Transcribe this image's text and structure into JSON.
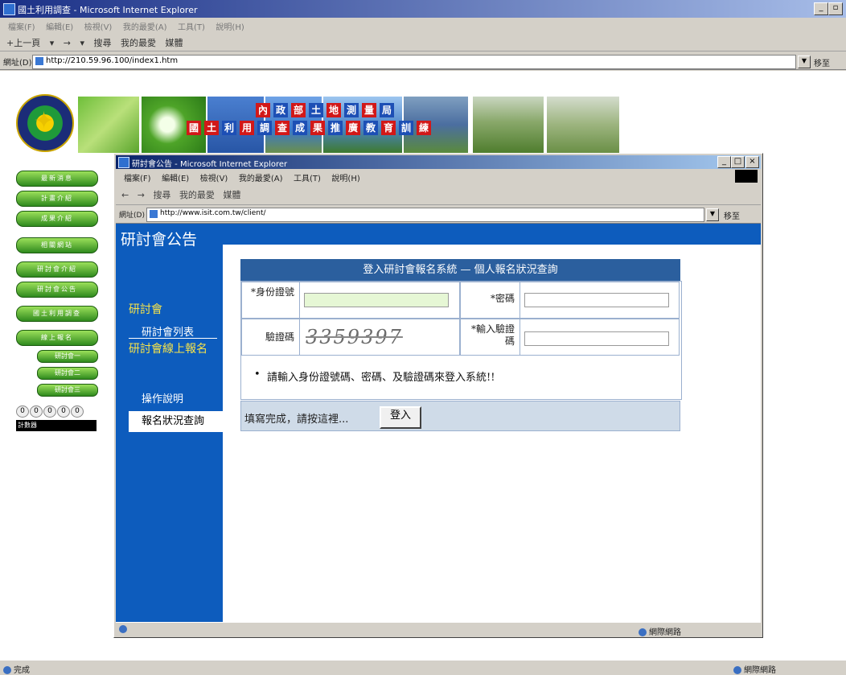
{
  "outer_window": {
    "title": "國土利用調查 - Microsoft Internet Explorer",
    "menu": [
      "檔案(F)",
      "編輯(E)",
      "檢視(V)",
      "我的最愛(A)",
      "工具(T)",
      "說明(H)"
    ],
    "toolbar": [
      "+上一頁",
      "▾",
      "→",
      "▾",
      "搜尋",
      "我的最愛",
      "媒體"
    ],
    "address_label": "網址(D)",
    "address_url": "http://210.59.96.100/index1.htm",
    "go_label": "移至",
    "status_text": "完成",
    "zone_text": "網際網路",
    "minimize": "_",
    "maximize": "▫"
  },
  "banner": {
    "characters_top": [
      "內",
      "政",
      "部",
      "土",
      "地",
      "測",
      "量",
      "局"
    ],
    "characters_bottom": [
      "國",
      "土",
      "利",
      "用",
      "調",
      "查",
      "成",
      "果",
      "推",
      "廣",
      "教",
      "育",
      "訓",
      "練"
    ]
  },
  "left_nav": {
    "items": [
      "最新消息",
      "計畫介紹",
      "成果介紹",
      "相關網站",
      "研討會介紹",
      "研討會公告",
      "國土利用調查",
      "線上報名"
    ],
    "sub_items": [
      "研討會一",
      "研討會二",
      "研討會三"
    ],
    "counter": [
      "0",
      "0",
      "0",
      "0",
      "0"
    ],
    "footer": "計數器"
  },
  "inner_window": {
    "title": "研討會公告 - Microsoft Internet Explorer",
    "menu": [
      "檔案(F)",
      "編輯(E)",
      "檢視(V)",
      "我的最愛(A)",
      "工具(T)",
      "說明(H)"
    ],
    "toolbar": [
      "←",
      "→",
      "搜尋",
      "我的最愛",
      "媒體"
    ],
    "address_label": "網址(D)",
    "address_url": "http://www.isit.com.tw/client/",
    "go_label": "移至",
    "zone_text": "網際網路",
    "minimize": "_",
    "maximize": "□",
    "close": "×"
  },
  "page": {
    "sidebar_heading": "研討會公告",
    "section1": "研討會",
    "item1": "研討會列表",
    "section2": "研討會線上報名",
    "item2": "操作說明",
    "active_item": "報名狀況查詢"
  },
  "form": {
    "header": "登入研討會報名系統 — 個人報名狀況查詢",
    "id_label": "*身份證號",
    "password_label": "*密碼",
    "captcha_label": "驗證碼",
    "captcha_value": "3359397",
    "captcha_input_label": "*輸入驗證碼",
    "note": "請輸入身份證號碼、密碼、及驗證碼來登入系統!!",
    "footer_text": "填寫完成，請按這裡...",
    "login_button": "登入",
    "id_value": "",
    "password_value": "",
    "captcha_input_value": ""
  }
}
